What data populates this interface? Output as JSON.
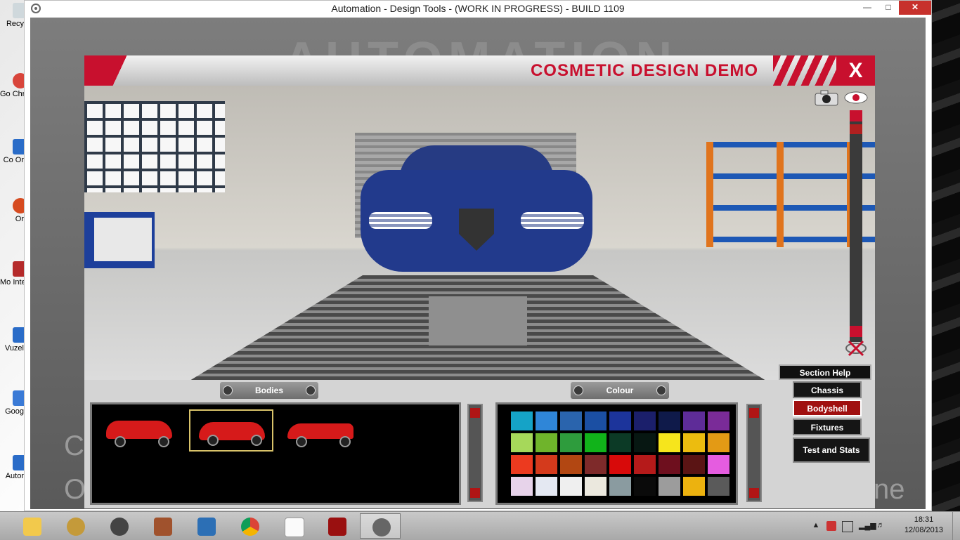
{
  "window": {
    "title": "Automation - Design Tools - (WORK IN PROGRESS) - BUILD 1109"
  },
  "desktop": {
    "icon_labels": [
      "Recy",
      "Go Chr",
      "Co Or",
      "Or",
      "Mo Intern",
      "Vuzel",
      "Goog",
      "Autor"
    ]
  },
  "background": {
    "logo_text": "AUTOMATION",
    "left_text": "C",
    "left_text2": "O",
    "right_text": "ne"
  },
  "panel": {
    "title": "COSMETIC DESIGN DEMO",
    "close_label": "X"
  },
  "bodies": {
    "label": "Bodies",
    "items": [
      {
        "name": "hatchback"
      },
      {
        "name": "sedan"
      },
      {
        "name": "coupe"
      }
    ],
    "selected_index": 1
  },
  "colour": {
    "label": "Colour",
    "swatches": [
      "#15a3c7",
      "#2f86d8",
      "#2a64ad",
      "#1b4fa3",
      "#1c349b",
      "#1b1f6b",
      "#0f1a4a",
      "#5e2c98",
      "#7a2b98",
      "#a6d85a",
      "#6fb42b",
      "#2e9c3d",
      "#11b31a",
      "#0c3a26",
      "#071712",
      "#f6e51c",
      "#ecbc0f",
      "#e39a15",
      "#ec3a1f",
      "#d43a1c",
      "#b24712",
      "#7e2a2a",
      "#d80a0a",
      "#b51a1a",
      "#6e0f1e",
      "#5a1414",
      "#e55ce0",
      "#e7d3ea",
      "#e4e8f2",
      "#efefef",
      "#ebe8de",
      "#8a9ba0",
      "#0a0a0a",
      "#9c9c9c",
      "#ecb20f",
      "#5a5a5a"
    ]
  },
  "side_panel": {
    "section_help": "Section Help",
    "buttons": [
      "Chassis",
      "Bodyshell",
      "Fixtures",
      "Test and Stats"
    ],
    "active": "Bodyshell"
  },
  "clock": {
    "time": "18:31",
    "date": "12/08/2013"
  },
  "colors": {
    "accent": "#c8102e"
  }
}
